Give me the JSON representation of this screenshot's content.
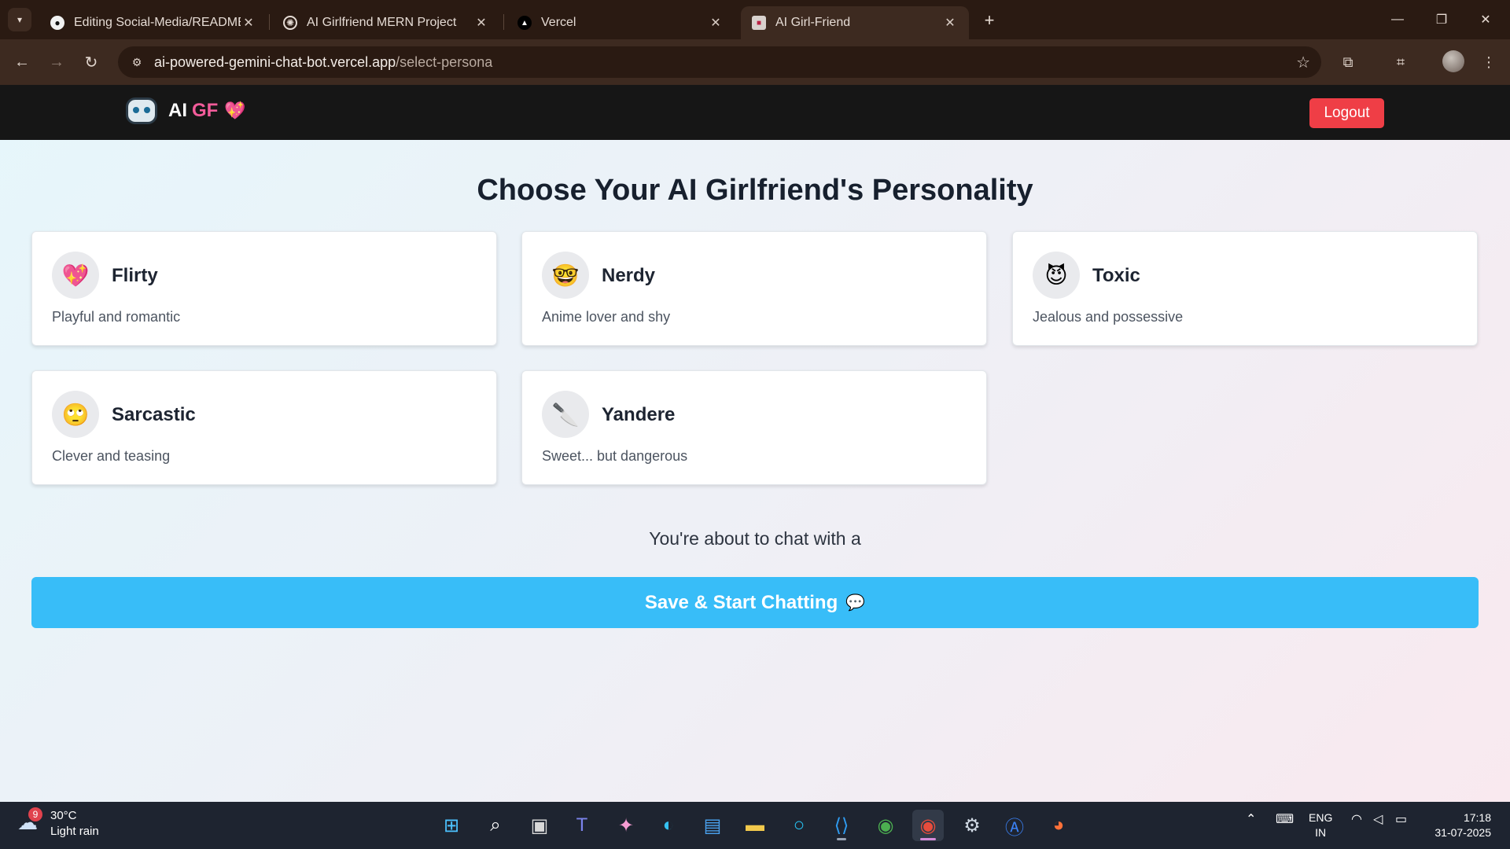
{
  "browser": {
    "tabs": [
      {
        "title": "Editing Social-Media/README.r",
        "icon": "github-icon"
      },
      {
        "title": "AI Girlfriend MERN Project",
        "icon": "openai-icon"
      },
      {
        "title": "Vercel",
        "icon": "vercel-icon"
      },
      {
        "title": "AI Girl-Friend",
        "icon": "site-favicon",
        "active": true
      }
    ],
    "url_host": "ai-powered-gemini-chat-bot.vercel.app",
    "url_path": "/select-persona"
  },
  "site": {
    "brand_ai": "AI",
    "brand_gf": "GF",
    "brand_heart": "💖",
    "logout_label": "Logout"
  },
  "page": {
    "heading": "Choose Your AI Girlfriend's Personality",
    "personas": [
      {
        "emoji": "💖",
        "title": "Flirty",
        "desc": "Playful and romantic"
      },
      {
        "emoji": "🤓",
        "title": "Nerdy",
        "desc": "Anime lover and shy"
      },
      {
        "emoji": "😈",
        "title": "Toxic",
        "desc": "Jealous and possessive"
      },
      {
        "emoji": "🙄",
        "title": "Sarcastic",
        "desc": "Clever and teasing"
      },
      {
        "emoji": "🔪",
        "title": "Yandere",
        "desc": "Sweet... but dangerous"
      }
    ],
    "about_text": "You're about to chat with a",
    "start_button": "Save & Start Chatting",
    "start_emoji": "💬"
  },
  "taskbar": {
    "weather_badge": "9",
    "temperature": "30°C",
    "weather_desc": "Light rain",
    "lang_line1": "ENG",
    "lang_line2": "IN",
    "time": "17:18",
    "date": "31-07-2025"
  },
  "colors": {
    "accent_button": "#38bdf8",
    "logout": "#ef3e46",
    "brand_pink": "#f25c9a"
  }
}
